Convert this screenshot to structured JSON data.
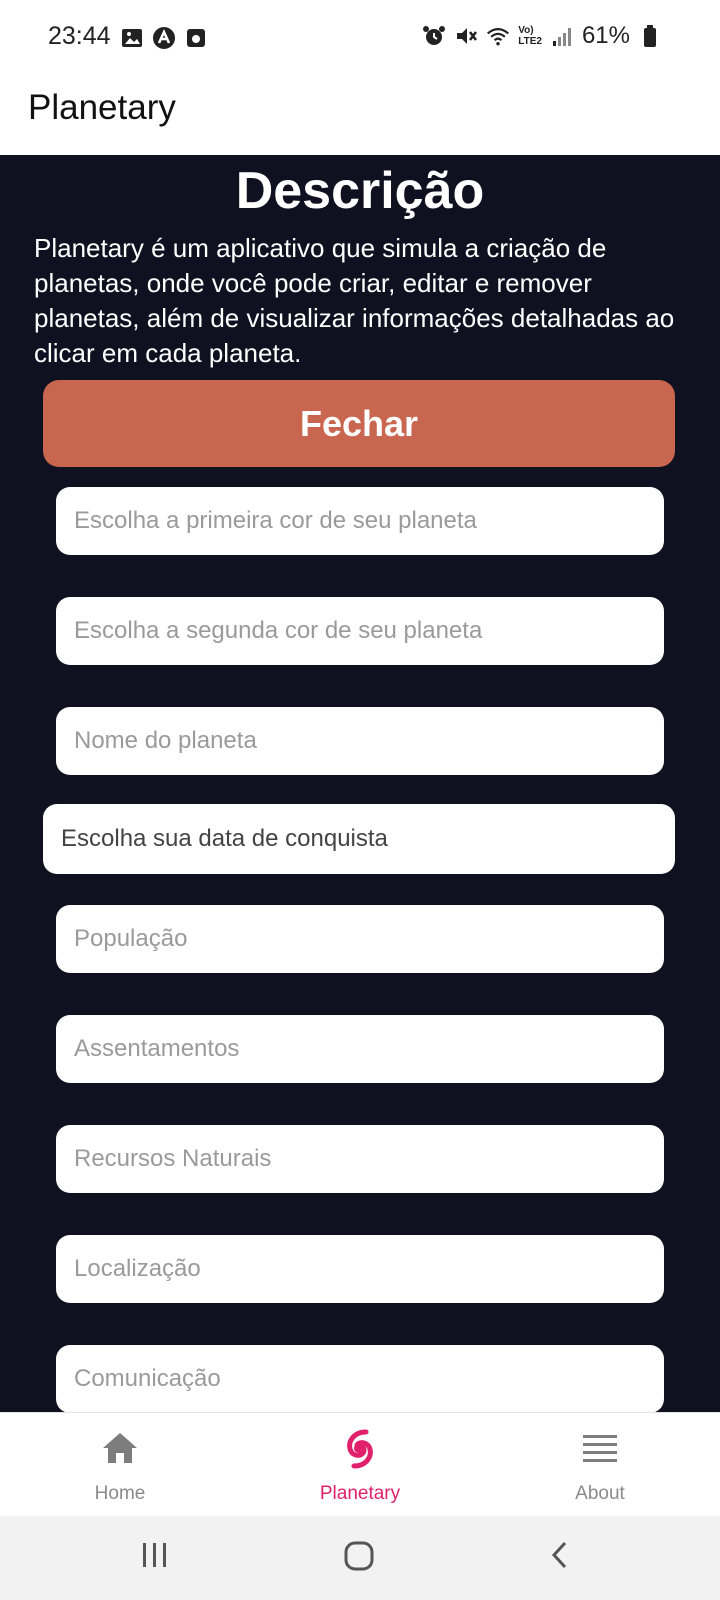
{
  "status_bar": {
    "time": "23:44",
    "battery_percent": "61%",
    "network_label_top": "Vo)",
    "network_label_bottom": "LTE2",
    "left_icons": [
      "image-icon",
      "notification-a-icon",
      "app-square-icon"
    ],
    "right_icons": [
      "alarm-icon",
      "mute-icon",
      "wifi-icon",
      "signal-icon",
      "battery-icon"
    ]
  },
  "app_bar": {
    "title": "Planetary"
  },
  "description": {
    "title": "Descrição",
    "text": "Planetary é um aplicativo que simula a criação de planetas, onde você pode criar, editar e remover planetas, além de visualizar informações detalhadas ao clicar em cada planeta.",
    "close_label": "Fechar"
  },
  "form": {
    "fields": [
      {
        "placeholder": "Escolha a primeira cor de seu planeta"
      },
      {
        "placeholder": "Escolha a segunda cor de seu planeta"
      },
      {
        "placeholder": "Nome do planeta"
      },
      {
        "label": "Escolha sua data de conquista"
      },
      {
        "placeholder": "População"
      },
      {
        "placeholder": "Assentamentos"
      },
      {
        "placeholder": "Recursos Naturais"
      },
      {
        "placeholder": "Localização"
      },
      {
        "placeholder": "Comunicação"
      }
    ]
  },
  "bottom_nav": {
    "items": [
      {
        "label": "Home",
        "icon": "home-icon"
      },
      {
        "label": "Planetary",
        "icon": "planet-swirl-icon",
        "active": true
      },
      {
        "label": "About",
        "icon": "list-icon"
      }
    ]
  },
  "colors": {
    "content_bg": "#0f1120",
    "accent_button": "#c9664f",
    "active_nav": "#e0206b"
  }
}
